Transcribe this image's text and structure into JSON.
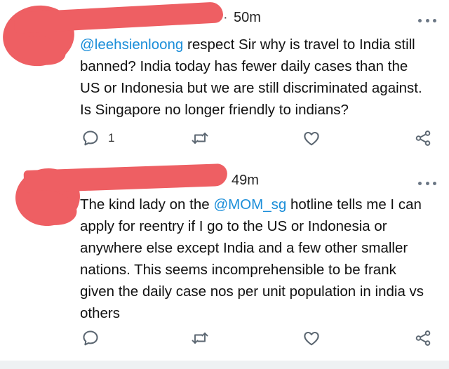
{
  "tweets": [
    {
      "time": "50m",
      "mention": "@leehsienloong",
      "text_after_mention": " respect Sir why is travel to India still banned? India today has fewer daily cases than the US or Indonesia but we are still discriminated against. Is Singapore no longer friendly to indians?",
      "reply_count": "1"
    },
    {
      "time": "49m",
      "text_before_mention": "The kind lady on the ",
      "mention": "@MOM_sg",
      "text_after_mention": " hotline tells me I can apply for reentry if I go to the US or Indonesia or anywhere else except India and a few other smaller nations. This seems incomprehensible to be frank given the daily case nos per unit population in india vs others",
      "reply_count": ""
    }
  ],
  "icons": {
    "reply": "speech-bubble-icon",
    "retweet": "retweet-icon",
    "like": "heart-icon",
    "share": "share-icon",
    "more": "more-dots-icon"
  },
  "colors": {
    "mention": "#1b8ed9",
    "redaction": "#ee5f63",
    "icon": "#5b6671"
  }
}
